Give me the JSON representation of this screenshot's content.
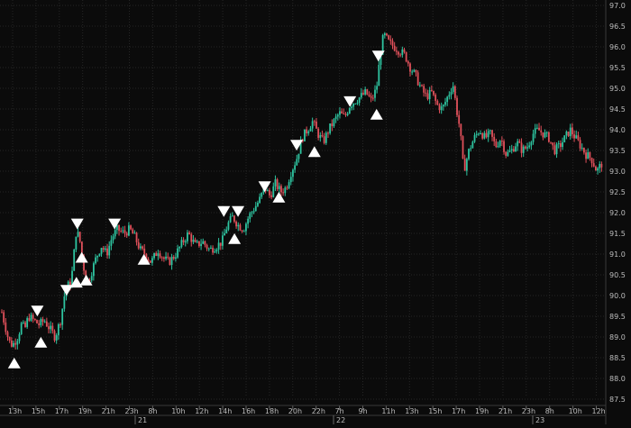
{
  "colors": {
    "background": "#0b0b0b",
    "grid": "#262626",
    "axis_text": "#bdbdbd",
    "up_candle": "#2ec4a0",
    "down_candle": "#e0505a",
    "signal_marker": "#ffffff"
  },
  "chart_data": {
    "type": "candlestick",
    "title": "",
    "xlabel": "",
    "ylabel": "",
    "grid": true,
    "ylim": [
      87.5,
      97.0
    ],
    "y_axis_side": "right",
    "y_ticks": [
      "97.0",
      "96.5",
      "96.0",
      "95.5",
      "95.0",
      "94.5",
      "94.0",
      "93.5",
      "93.0",
      "92.5",
      "92.0",
      "91.5",
      "91.0",
      "90.5",
      "90.0",
      "89.5",
      "89.0",
      "88.5",
      "88.0",
      "87.5"
    ],
    "x_hour_ticks": [
      "13h",
      "15h",
      "17h",
      "19h",
      "21h",
      "23h",
      "8h",
      "10h",
      "12h",
      "14h",
      "16h",
      "18h",
      "20h",
      "22h",
      "7h",
      "9h",
      "11h",
      "13h",
      "15h",
      "17h",
      "19h",
      "21h",
      "23h",
      "8h",
      "10h",
      "12h"
    ],
    "x_day_ticks": [
      "21",
      "22",
      "23"
    ],
    "close_path": [
      [
        0,
        89.6
      ],
      [
        8,
        88.9
      ],
      [
        12,
        88.8
      ],
      [
        18,
        89.0
      ],
      [
        22,
        89.3
      ],
      [
        26,
        89.2
      ],
      [
        30,
        89.5
      ],
      [
        36,
        89.4
      ],
      [
        42,
        89.3
      ],
      [
        48,
        89.4
      ],
      [
        54,
        89.2
      ],
      [
        60,
        89.0
      ],
      [
        66,
        89.4
      ],
      [
        72,
        90.2
      ],
      [
        78,
        90.3
      ],
      [
        84,
        91.6
      ],
      [
        88,
        91.3
      ],
      [
        92,
        90.7
      ],
      [
        96,
        90.3
      ],
      [
        100,
        90.5
      ],
      [
        106,
        90.9
      ],
      [
        112,
        91.2
      ],
      [
        118,
        91.0
      ],
      [
        124,
        91.4
      ],
      [
        130,
        91.6
      ],
      [
        138,
        91.5
      ],
      [
        144,
        91.6
      ],
      [
        150,
        91.4
      ],
      [
        156,
        91.1
      ],
      [
        162,
        91.0
      ],
      [
        168,
        90.8
      ],
      [
        176,
        91.1
      ],
      [
        182,
        90.9
      ],
      [
        188,
        90.8
      ],
      [
        196,
        91.0
      ],
      [
        204,
        91.3
      ],
      [
        210,
        91.5
      ],
      [
        218,
        91.2
      ],
      [
        226,
        91.3
      ],
      [
        234,
        91.1
      ],
      [
        242,
        91.2
      ],
      [
        248,
        91.3
      ],
      [
        254,
        91.7
      ],
      [
        260,
        91.9
      ],
      [
        266,
        91.7
      ],
      [
        272,
        91.6
      ],
      [
        278,
        91.9
      ],
      [
        284,
        92.1
      ],
      [
        290,
        92.3
      ],
      [
        296,
        92.6
      ],
      [
        302,
        92.4
      ],
      [
        308,
        92.7
      ],
      [
        314,
        92.5
      ],
      [
        320,
        92.6
      ],
      [
        326,
        93.0
      ],
      [
        332,
        93.3
      ],
      [
        338,
        93.8
      ],
      [
        344,
        94.0
      ],
      [
        350,
        94.2
      ],
      [
        356,
        93.9
      ],
      [
        362,
        93.7
      ],
      [
        368,
        94.0
      ],
      [
        374,
        94.2
      ],
      [
        380,
        94.4
      ],
      [
        386,
        94.3
      ],
      [
        392,
        94.6
      ],
      [
        398,
        94.7
      ],
      [
        404,
        94.8
      ],
      [
        410,
        94.9
      ],
      [
        416,
        94.7
      ],
      [
        422,
        95.0
      ],
      [
        426,
        95.8
      ],
      [
        430,
        96.3
      ],
      [
        436,
        96.1
      ],
      [
        442,
        96.0
      ],
      [
        448,
        95.9
      ],
      [
        454,
        95.8
      ],
      [
        460,
        95.5
      ],
      [
        466,
        95.3
      ],
      [
        472,
        95.0
      ],
      [
        478,
        94.8
      ],
      [
        484,
        94.9
      ],
      [
        490,
        94.6
      ],
      [
        496,
        94.5
      ],
      [
        502,
        94.8
      ],
      [
        508,
        95.1
      ],
      [
        512,
        94.5
      ],
      [
        516,
        94.0
      ],
      [
        520,
        93.0
      ],
      [
        526,
        93.5
      ],
      [
        532,
        93.8
      ],
      [
        538,
        94.0
      ],
      [
        544,
        93.8
      ],
      [
        550,
        93.9
      ],
      [
        556,
        93.6
      ],
      [
        562,
        93.8
      ],
      [
        568,
        93.4
      ],
      [
        574,
        93.5
      ],
      [
        580,
        93.7
      ],
      [
        586,
        93.5
      ],
      [
        592,
        93.6
      ],
      [
        598,
        93.9
      ],
      [
        604,
        94.0
      ],
      [
        610,
        93.9
      ],
      [
        616,
        93.8
      ],
      [
        622,
        93.5
      ],
      [
        628,
        93.6
      ],
      [
        634,
        93.8
      ],
      [
        640,
        94.0
      ],
      [
        646,
        93.8
      ],
      [
        652,
        93.6
      ],
      [
        658,
        93.4
      ],
      [
        664,
        93.3
      ],
      [
        670,
        93.0
      ],
      [
        676,
        93.2
      ]
    ],
    "signal_markers": [
      {
        "t": 14,
        "price": 88.35,
        "dir": "up"
      },
      {
        "t": 40,
        "price": 89.65,
        "dir": "down"
      },
      {
        "t": 44,
        "price": 88.85,
        "dir": "up"
      },
      {
        "t": 73,
        "price": 90.15,
        "dir": "down"
      },
      {
        "t": 84,
        "price": 90.3,
        "dir": "up"
      },
      {
        "t": 85,
        "price": 91.75,
        "dir": "down"
      },
      {
        "t": 90,
        "price": 90.9,
        "dir": "up"
      },
      {
        "t": 95,
        "price": 90.35,
        "dir": "up"
      },
      {
        "t": 127,
        "price": 91.75,
        "dir": "down"
      },
      {
        "t": 160,
        "price": 90.85,
        "dir": "up"
      },
      {
        "t": 250,
        "price": 92.05,
        "dir": "down"
      },
      {
        "t": 262,
        "price": 91.35,
        "dir": "up"
      },
      {
        "t": 266,
        "price": 92.05,
        "dir": "down"
      },
      {
        "t": 296,
        "price": 92.65,
        "dir": "down"
      },
      {
        "t": 312,
        "price": 92.35,
        "dir": "up"
      },
      {
        "t": 332,
        "price": 93.65,
        "dir": "down"
      },
      {
        "t": 352,
        "price": 93.45,
        "dir": "up"
      },
      {
        "t": 392,
        "price": 94.7,
        "dir": "down"
      },
      {
        "t": 424,
        "price": 95.8,
        "dir": "down"
      },
      {
        "t": 422,
        "price": 94.35,
        "dir": "up"
      }
    ]
  }
}
